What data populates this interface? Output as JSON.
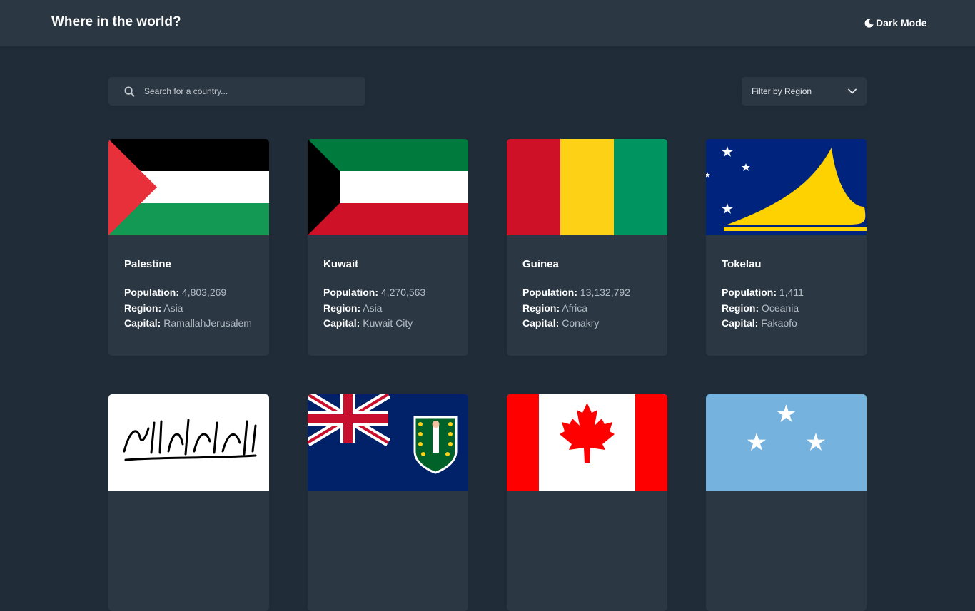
{
  "header": {
    "title": "Where in the world?",
    "mode_label": "Dark Mode",
    "mode_icon": "moon-icon"
  },
  "search": {
    "placeholder": "Search for a country...",
    "icon": "search-icon"
  },
  "filter": {
    "label": "Filter by Region",
    "icon": "chevron-down-icon"
  },
  "labels": {
    "population": "Population:",
    "region": "Region:",
    "capital": "Capital:"
  },
  "colors": {
    "background": "#202c37",
    "element": "#2b3844",
    "text": "#ffffff",
    "muted": "#b4bcc4"
  },
  "countries": [
    {
      "name": "Palestine",
      "population": "4,803,269",
      "region": "Asia",
      "capital": "RamallahJerusalem",
      "flag": "palestine-flag"
    },
    {
      "name": "Kuwait",
      "population": "4,270,563",
      "region": "Asia",
      "capital": "Kuwait City",
      "flag": "kuwait-flag"
    },
    {
      "name": "Guinea",
      "population": "13,132,792",
      "region": "Africa",
      "capital": "Conakry",
      "flag": "guinea-flag"
    },
    {
      "name": "Tokelau",
      "population": "1,411",
      "region": "Oceania",
      "capital": "Fakaofo",
      "flag": "tokelau-flag"
    },
    {
      "flag": "afghanistan-flag"
    },
    {
      "flag": "british-virgin-islands-flag"
    },
    {
      "flag": "canada-flag"
    },
    {
      "flag": "micronesia-flag"
    }
  ]
}
